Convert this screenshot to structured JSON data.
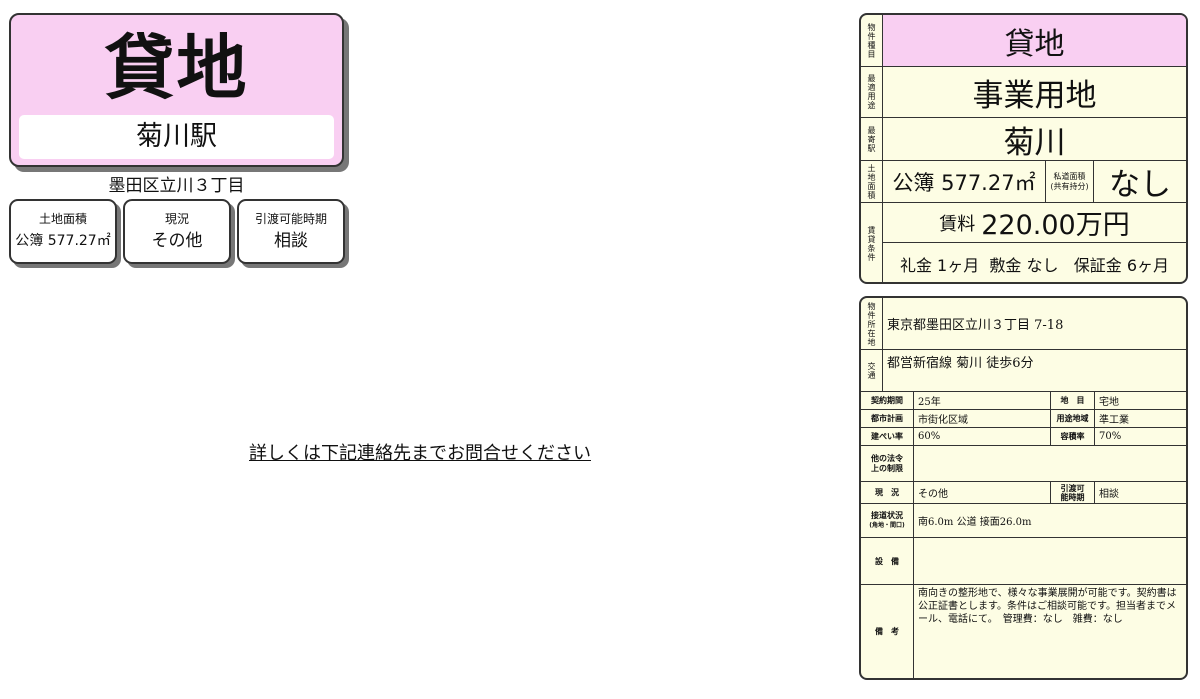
{
  "left": {
    "title": "貸地",
    "station": "菊川駅",
    "address": "墨田区立川３丁目",
    "summary": [
      {
        "label": "土地面積",
        "value": "公簿 577.27㎡"
      },
      {
        "label": "現況",
        "value": "その他"
      },
      {
        "label": "引渡可能時期",
        "value": "相談"
      }
    ],
    "contact_note": "詳しくは下記連絡先までお問合せください"
  },
  "top_panel": {
    "type_label": "物件種目",
    "type_value": "貸地",
    "use_label": "最適用途",
    "use_value": "事業用地",
    "station_label": "最寄駅",
    "station_value": "菊川",
    "area_label": "土地面積",
    "area_value": "公簿 577.27㎡",
    "private_road_label": "私道面積",
    "private_road_sublabel": "(共有持分)",
    "private_road_value": "なし",
    "terms_label": "賃貸条件",
    "rent_prefix": "賃料",
    "rent_value": "220.00万円",
    "deposits": "礼金 1ヶ月  敷金 なし   保証金 6ヶ月"
  },
  "bottom_panel": {
    "location_label": "物件所在地",
    "location_value": "東京都墨田区立川３丁目 7-18",
    "transport_label": "交通",
    "transport_value": "都営新宿線 菊川 徒歩6分",
    "contract_label": "契約期間",
    "contract_value": "25年",
    "land_cat_label": "地　目",
    "land_cat_value": "宅地",
    "city_plan_label": "都市計画",
    "city_plan_value": "市街化区域",
    "zoning_label": "用途地域",
    "zoning_value": "準工業",
    "coverage_label": "建ぺい率",
    "coverage_value": "60%",
    "far_label": "容積率",
    "far_value": "70%",
    "other_law_label": "他の法令上の制限",
    "other_law_value": "",
    "status_label": "現　況",
    "status_value": "その他",
    "handover_label": "引渡可能時期",
    "handover_value": "相談",
    "road_label": "接道状況",
    "road_sublabel": "(角地・間口)",
    "road_value": "南6.0m 公道 接面26.0m",
    "facilities_label": "設　備",
    "facilities_value": "",
    "remarks_label": "備　考",
    "remarks_value": "南向きの整形地で、様々な事業展開が可能です。契約書は公正証書とします。条件はご相談可能です。担当者までメール、電話にて。　管理費：なし　雑費：なし"
  }
}
